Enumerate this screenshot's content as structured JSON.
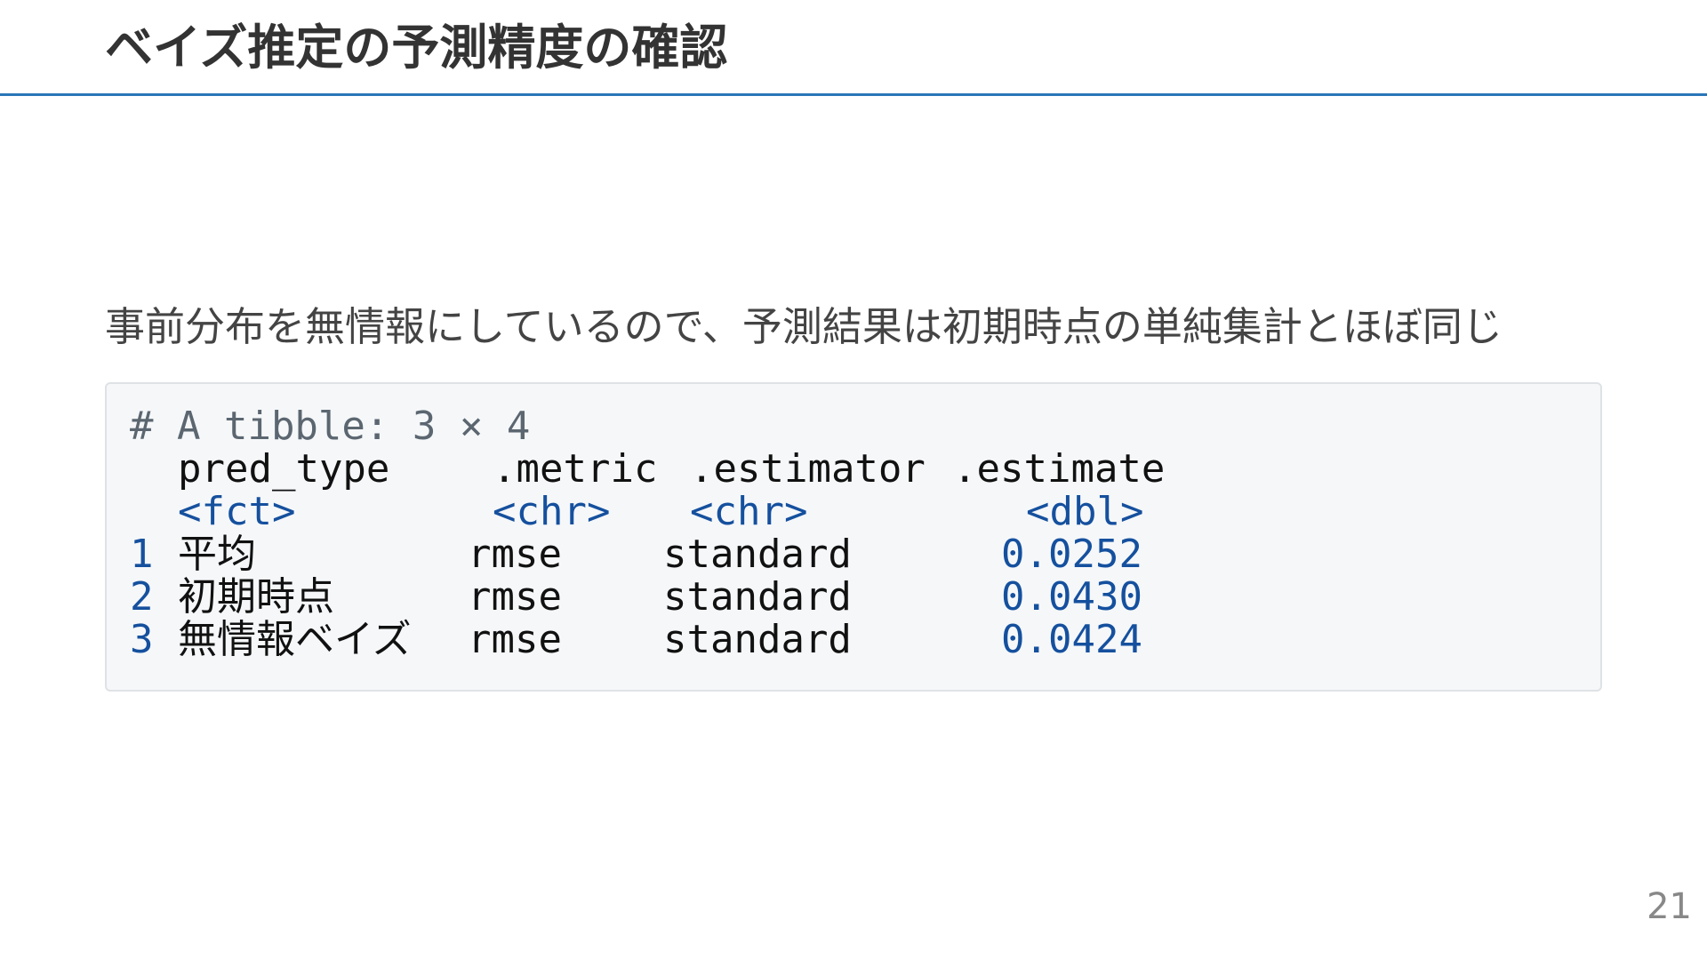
{
  "slide": {
    "title": "ベイズ推定の予測精度の確認",
    "lead": "事前分布を無情報にしているので、予測結果は初期時点の単純集計とほぼ同じ",
    "page_number": "21"
  },
  "code_output": {
    "comment": "# A tibble: 3 × 4",
    "headers": [
      "pred_type",
      ".metric",
      ".estimator",
      ".estimate"
    ],
    "types": [
      "<fct>",
      "<chr>",
      "<chr>",
      "<dbl>"
    ],
    "rows": [
      {
        "index": "1",
        "pred_type": "平均",
        "metric": "rmse",
        "estimator": "standard",
        "estimate": "0.0252"
      },
      {
        "index": "2",
        "pred_type": "初期時点",
        "metric": "rmse",
        "estimator": "standard",
        "estimate": "0.0430"
      },
      {
        "index": "3",
        "pred_type": "無情報ベイズ",
        "metric": "rmse",
        "estimator": "standard",
        "estimate": "0.0424"
      }
    ]
  },
  "colors": {
    "title_rule": "#2a76b8",
    "code_background": "#f5f7f9",
    "code_blue": "#15509e",
    "comment_gray": "#5b6670"
  }
}
